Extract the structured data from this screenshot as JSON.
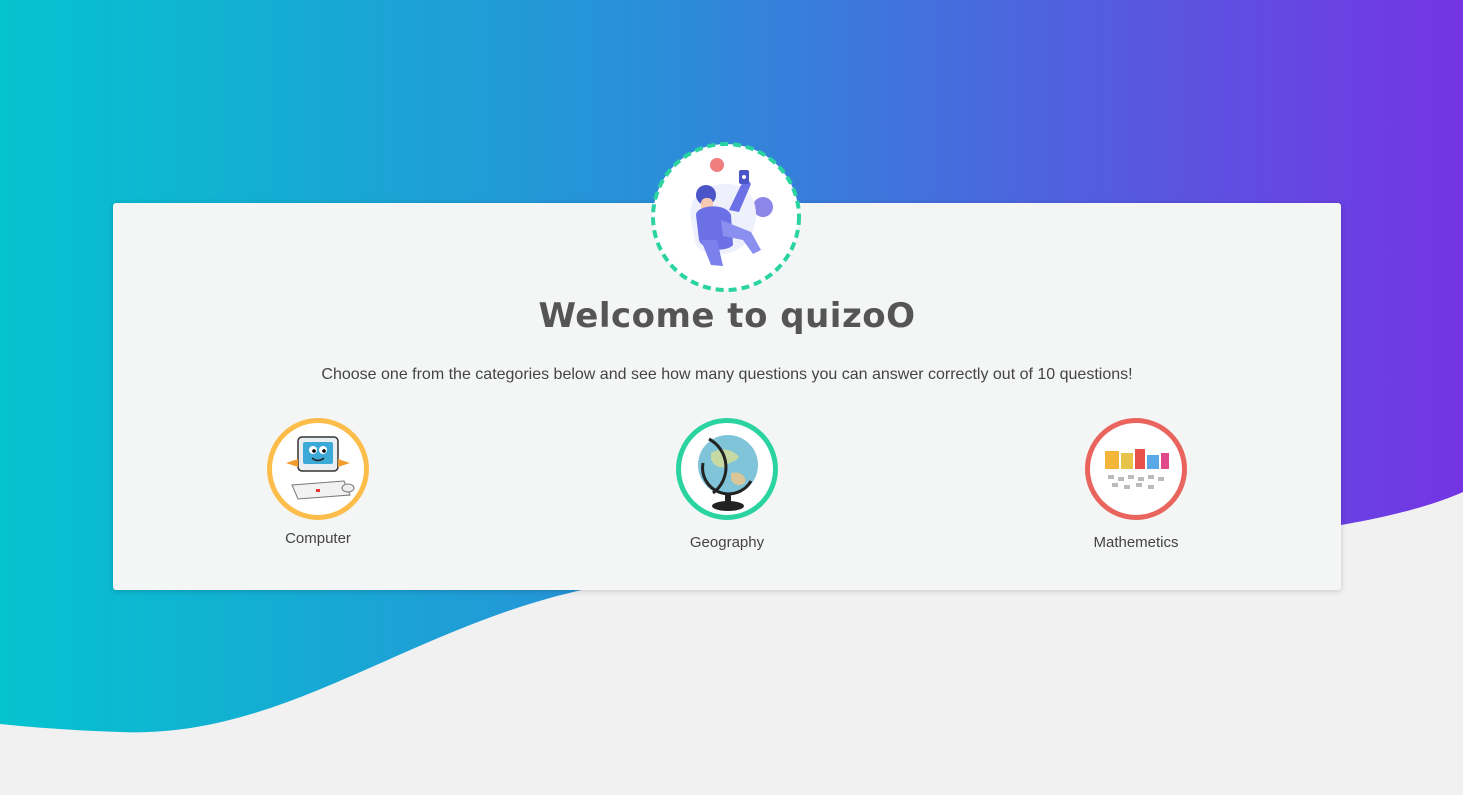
{
  "colors": {
    "gradient_left": "#05c3cf",
    "gradient_mid": "#2a8ed9",
    "gradient_right": "#7534e4",
    "hero_ring": "#2ad3a0",
    "title_text": "#555555"
  },
  "hero": {
    "icon": "astronaut-illustration"
  },
  "welcome": {
    "title": "Welcome to quizoO",
    "subtitle": "Choose one from the categories below and see how many questions you can answer correctly out of 10 questions!"
  },
  "categories": [
    {
      "label": "Computer",
      "icon": "computer-icon",
      "ring_color": "#fcbd4a"
    },
    {
      "label": "Geography",
      "icon": "globe-icon",
      "ring_color": "#2ad3a0"
    },
    {
      "label": "Mathemetics",
      "icon": "math-icon",
      "ring_color": "#ea645e"
    }
  ]
}
